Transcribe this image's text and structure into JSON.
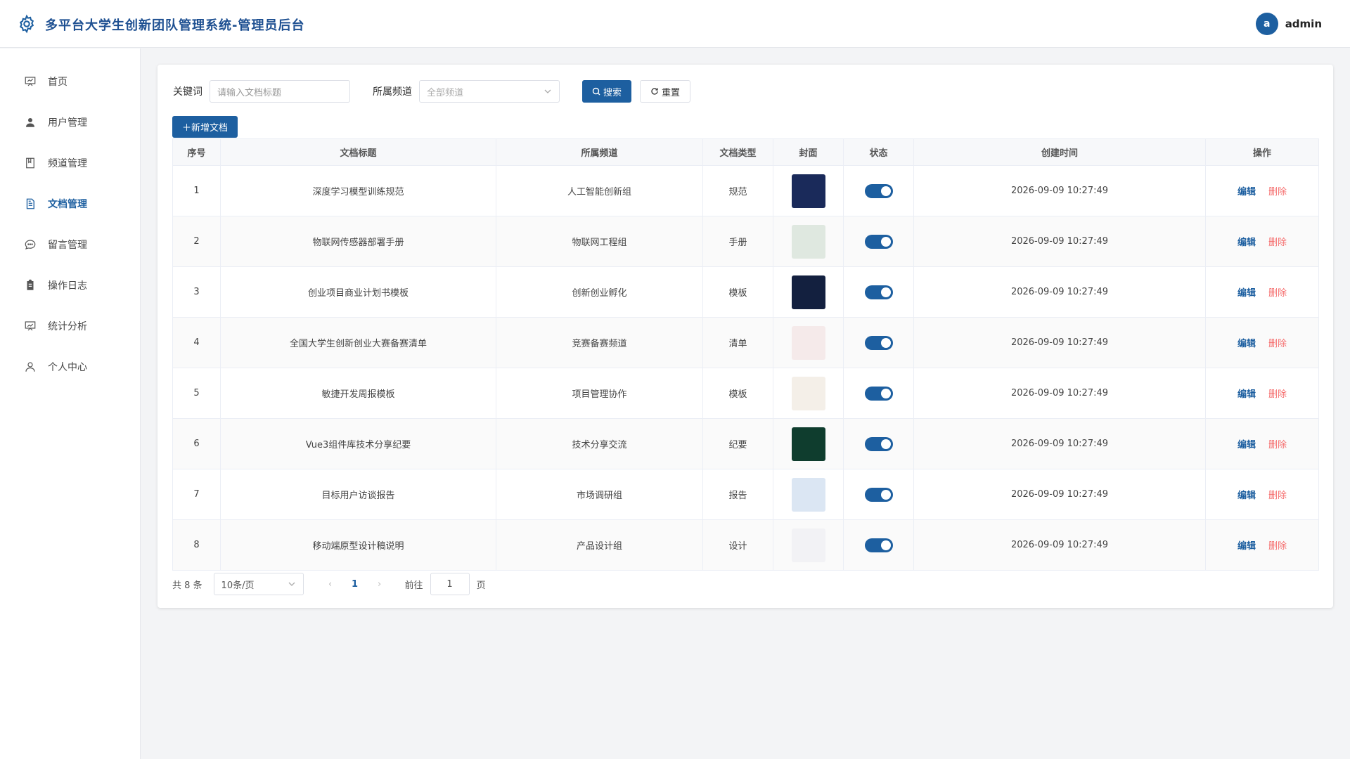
{
  "header": {
    "title": "多平台大学生创新团队管理系统-管理员后台",
    "avatar_letter": "a",
    "username": "admin"
  },
  "sidebar": {
    "items": [
      {
        "label": "首页",
        "icon": "presentation-icon"
      },
      {
        "label": "用户管理",
        "icon": "user-icon"
      },
      {
        "label": "频道管理",
        "icon": "notebook-icon"
      },
      {
        "label": "文档管理",
        "icon": "document-icon",
        "active": true
      },
      {
        "label": "留言管理",
        "icon": "chat-icon"
      },
      {
        "label": "操作日志",
        "icon": "clipboard-icon"
      },
      {
        "label": "统计分析",
        "icon": "chart-icon"
      },
      {
        "label": "个人中心",
        "icon": "person-icon"
      }
    ]
  },
  "filters": {
    "keyword_label": "关键词",
    "keyword_placeholder": "请输入文档标题",
    "channel_label": "所属频道",
    "channel_value": "全部频道",
    "search_label": "搜索",
    "reset_label": "重置"
  },
  "add_button": "＋新增文档",
  "table": {
    "columns": [
      "序号",
      "文档标题",
      "所属频道",
      "文档类型",
      "封面",
      "状态",
      "创建时间",
      "操作"
    ],
    "rows": [
      {
        "index": "1",
        "title": "深度学习模型训练规范",
        "channel": "人工智能创新组",
        "type": "规范",
        "time": "2026-09-09 10:27:49",
        "enabled": true,
        "cover_color": "#1a2a5a"
      },
      {
        "index": "2",
        "title": "物联网传感器部署手册",
        "channel": "物联网工程组",
        "type": "手册",
        "time": "2026-09-09 10:27:49",
        "enabled": true,
        "cover_color": "#dfe8e0"
      },
      {
        "index": "3",
        "title": "创业项目商业计划书模板",
        "channel": "创新创业孵化",
        "type": "模板",
        "time": "2026-09-09 10:27:49",
        "enabled": true,
        "cover_color": "#13203f"
      },
      {
        "index": "4",
        "title": "全国大学生创新创业大赛备赛清单",
        "channel": "竞赛备赛频道",
        "type": "清单",
        "time": "2026-09-09 10:27:49",
        "enabled": true,
        "cover_color": "#f5eaea"
      },
      {
        "index": "5",
        "title": "敏捷开发周报模板",
        "channel": "项目管理协作",
        "type": "模板",
        "time": "2026-09-09 10:27:49",
        "enabled": true,
        "cover_color": "#f4efe8"
      },
      {
        "index": "6",
        "title": "Vue3组件库技术分享纪要",
        "channel": "技术分享交流",
        "type": "纪要",
        "time": "2026-09-09 10:27:49",
        "enabled": true,
        "cover_color": "#0f3d2e"
      },
      {
        "index": "7",
        "title": "目标用户访谈报告",
        "channel": "市场调研组",
        "type": "报告",
        "time": "2026-09-09 10:27:49",
        "enabled": true,
        "cover_color": "#dbe6f3"
      },
      {
        "index": "8",
        "title": "移动端原型设计稿说明",
        "channel": "产品设计组",
        "type": "设计",
        "time": "2026-09-09 10:27:49",
        "enabled": true,
        "cover_color": "#f2f2f5"
      }
    ],
    "edit_label": "编辑",
    "delete_label": "删除"
  },
  "pagination": {
    "total_text": "共 8 条",
    "page_size": "10条/页",
    "current_page": "1",
    "goto_label": "前往",
    "goto_value": "1",
    "page_suffix": "页"
  },
  "colors": {
    "primary": "#1d5fa0",
    "danger": "#f56c6c"
  }
}
